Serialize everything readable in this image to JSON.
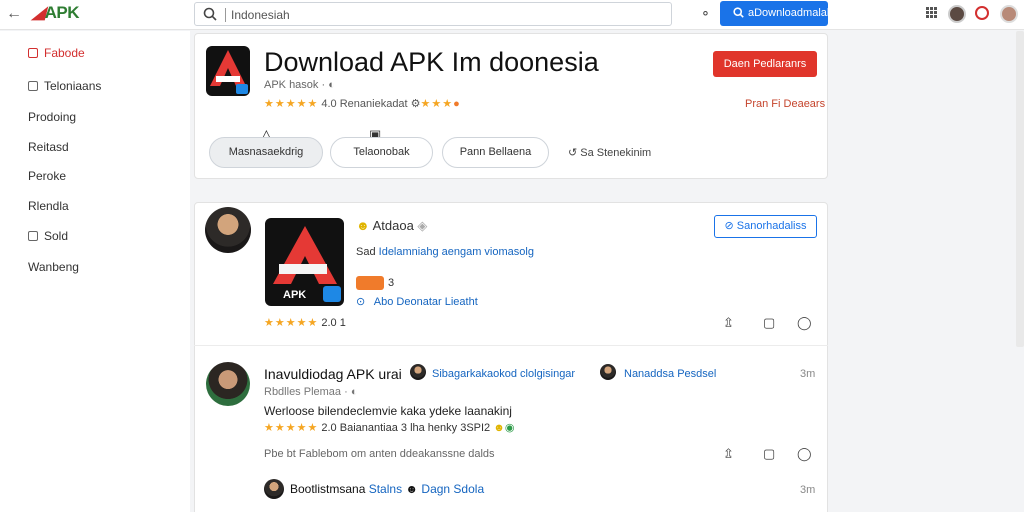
{
  "topbar": {
    "brand": "APK",
    "search_value": "Indonesiah",
    "download_button": "aDownloadmalal"
  },
  "sidebar": {
    "items": [
      {
        "label": "Fabode",
        "icon": "square-icon",
        "active": true
      },
      {
        "label": "Teloniaans",
        "icon": "square-icon",
        "active": false
      },
      {
        "label": "Prodoing",
        "icon": "",
        "active": false
      },
      {
        "label": "Reitasd",
        "icon": "",
        "active": false
      },
      {
        "label": "Peroke",
        "icon": "",
        "active": false
      },
      {
        "label": "Rlendla",
        "icon": "",
        "active": false
      },
      {
        "label": "Sold",
        "icon": "square-icon",
        "active": false
      },
      {
        "label": "Wanbeng",
        "icon": "",
        "active": false
      }
    ]
  },
  "app": {
    "title": "Download APK Im doonesia",
    "subtitle": "APK hasok",
    "stars": "★★★★★",
    "rating_text": "4.0  Renaniekadat",
    "primary_button": "Daen Pedlaranrs",
    "side_link": "Pran Fi Deaears",
    "actions": [
      {
        "label": "Masnasaekdrig",
        "icon": "bell-icon"
      },
      {
        "label": "Telaonobak",
        "icon": "camera-icon"
      },
      {
        "label": "Pann Bellaena",
        "icon": ""
      }
    ],
    "share_label": "Sa Stenekinim"
  },
  "post1": {
    "author": "Atdaoa",
    "desc": "Idelamniahg aengam viomasolg",
    "desc_prefix": "Sad",
    "tag_count": "3",
    "meta_text": "Abo Deonatar  Lieatht",
    "rating_text": "2.0  1",
    "follow_button": "Sanorhadaliss",
    "app_label": "APK"
  },
  "post2": {
    "title": "Inavuldiodag APK urai",
    "linked_name": "Sibagarkakaokod clolgisingar",
    "linked_name2": "Nanaddsa Pesdsel",
    "time": "3m",
    "sub": "Rbdlles Plemaa",
    "body": "Werloose bilendeclemvie kaka ydeke laanakinj",
    "rating_value": "2.0",
    "rating_text": "Baianantiaa 3 lha henky 3SPI2",
    "footer": "Pbe bt Fablebom om anten ddeakanssne dalds",
    "reply_author": "Bootlistmsana",
    "reply_tag": "Stalns",
    "reply_extra": "Dagn Sdola",
    "reply_time": "3m"
  }
}
